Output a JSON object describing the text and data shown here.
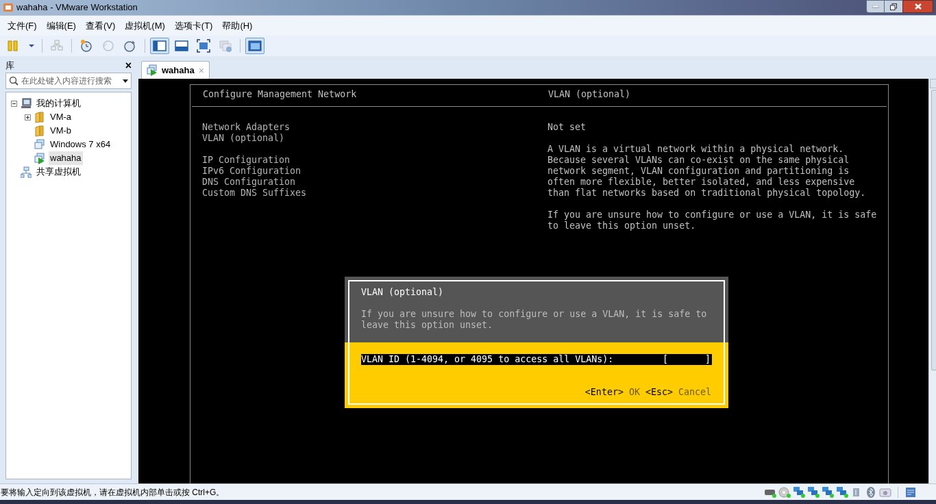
{
  "window": {
    "title": "wahaha - VMware Workstation"
  },
  "menu": [
    "文件(F)",
    "编辑(E)",
    "查看(V)",
    "虚拟机(M)",
    "选项卡(T)",
    "帮助(H)"
  ],
  "toolbar": [
    {
      "kind": "pause",
      "selected": false,
      "disabled": false
    },
    {
      "kind": "caret",
      "selected": false,
      "disabled": false
    },
    {
      "kind": "sep"
    },
    {
      "kind": "network",
      "selected": false,
      "disabled": true
    },
    {
      "kind": "sep"
    },
    {
      "kind": "snapshot",
      "selected": false,
      "disabled": false
    },
    {
      "kind": "revert",
      "selected": false,
      "disabled": true
    },
    {
      "kind": "snapshot-manager",
      "selected": false,
      "disabled": false
    },
    {
      "kind": "sep"
    },
    {
      "kind": "library-view",
      "selected": true,
      "disabled": false
    },
    {
      "kind": "thumbnail-view",
      "selected": false,
      "disabled": false
    },
    {
      "kind": "fullscreen",
      "selected": false,
      "disabled": false
    },
    {
      "kind": "unity",
      "selected": false,
      "disabled": true
    },
    {
      "kind": "sep"
    },
    {
      "kind": "console-view",
      "selected": true,
      "disabled": false
    }
  ],
  "library": {
    "title": "库",
    "close": "×",
    "search": {
      "placeholder": "在此处键入内容进行搜索"
    },
    "tree": [
      {
        "label": "我的计算机",
        "kind": "computer",
        "expanded": true,
        "selected": false,
        "children": [
          {
            "label": "VM-a",
            "kind": "folder",
            "expanded": false,
            "selected": false
          },
          {
            "label": "VM-b",
            "kind": "folder",
            "selected": false
          },
          {
            "label": "Windows 7 x64",
            "kind": "vm",
            "selected": false
          },
          {
            "label": "wahaha",
            "kind": "vm-running",
            "selected": true
          }
        ]
      },
      {
        "label": "共享虚拟机",
        "kind": "shared",
        "selected": false
      }
    ]
  },
  "tabs": [
    {
      "label": "wahaha",
      "close": "×",
      "selected": true
    }
  ],
  "console": {
    "header_left": "Configure Management Network",
    "header_right": "VLAN (optional)",
    "menu_groups": [
      [
        "Network Adapters",
        "VLAN (optional)"
      ],
      [
        "IP Configuration",
        "IPv6 Configuration",
        "DNS Configuration",
        "Custom DNS Suffixes"
      ]
    ],
    "detail_value": "Not set",
    "paragraphs": [
      "A VLAN is a virtual network within a physical network. Because several VLANs can co-exist on the same physical network segment, VLAN configuration and partitioning is often more flexible, better isolated, and less expensive than flat networks based on traditional physical topology.",
      "If you are unsure how to configure or use a VLAN, it is safe to leave this option unset."
    ],
    "dialog": {
      "title": "VLAN (optional)",
      "text": "If you are unsure how to configure or use a VLAN, it is safe to leave this option unset.",
      "field": {
        "label": "VLAN ID (1-4094, or 4095 to access all VLANs):",
        "open": "[",
        "close": "]"
      },
      "actions": [
        {
          "key": "<Enter>",
          "label": "OK"
        },
        {
          "key": "<Esc>",
          "label": "Cancel"
        }
      ]
    }
  },
  "status_bar": {
    "text": "要将输入定向到该虚拟机，请在虚拟机内部单击或按 Ctrl+G。",
    "devices": [
      {
        "kind": "hdd"
      },
      {
        "kind": "cd"
      },
      {
        "kind": "network"
      },
      {
        "kind": "network"
      },
      {
        "kind": "network"
      },
      {
        "kind": "network"
      },
      {
        "kind": "usb"
      },
      {
        "kind": "bluetooth"
      },
      {
        "kind": "camera"
      },
      {
        "kind": "message"
      }
    ]
  }
}
